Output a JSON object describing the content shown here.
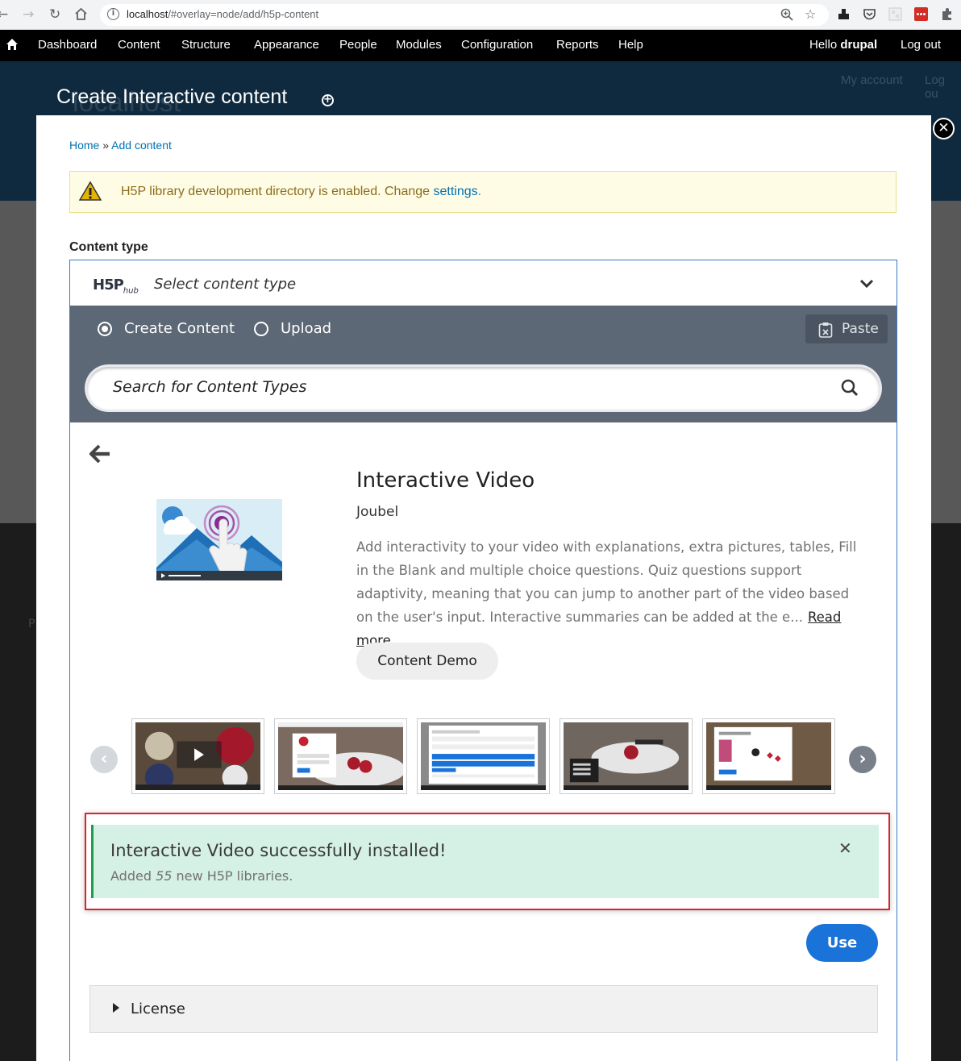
{
  "browser": {
    "url_host": "localhost",
    "url_path": "/#overlay=node/add/h5p-content"
  },
  "toolbar": {
    "items": [
      "Dashboard",
      "Content",
      "Structure",
      "Appearance",
      "People",
      "Modules",
      "Configuration",
      "Reports",
      "Help"
    ],
    "hello_prefix": "Hello",
    "user": "drupal",
    "logout": "Log out"
  },
  "background": {
    "site_name": "localhost",
    "my_account": "My account",
    "log_out": "Log ou",
    "fragment": "P"
  },
  "overlay": {
    "title": "Create Interactive content",
    "breadcrumb": {
      "home": "Home",
      "sep": "»",
      "add": "Add content"
    },
    "warning": {
      "text": "H5P library development directory is enabled. Change",
      "link": "settings",
      "end": "."
    },
    "content_type_label": "Content type"
  },
  "hub": {
    "logo": "H5P",
    "logo_sub": "hub",
    "select_label": "Select content type",
    "tabs": {
      "create": "Create Content",
      "upload": "Upload"
    },
    "paste": "Paste",
    "search_placeholder": "Search for Content Types",
    "detail": {
      "title": "Interactive Video",
      "author": "Joubel",
      "description": "Add interactivity to your video with explanations, extra pictures, tables, Fill in the Blank and multiple choice questions. Quiz questions support adaptivity, meaning that you can jump to another part of the video based on the user's input. Interactive summaries can be added at the e...",
      "read_more": "Read more",
      "demo_button": "Content Demo"
    },
    "message": {
      "title": "Interactive Video successfully installed!",
      "sub_prefix": "Added",
      "count": "55",
      "sub_suffix": "new H5P libraries."
    },
    "use_button": "Use",
    "license": "License"
  },
  "colors": {
    "accent": "#1a73d9",
    "tab_bg": "#5d6876",
    "success_bg": "#d5f0e4",
    "highlight": "#d9242c"
  }
}
